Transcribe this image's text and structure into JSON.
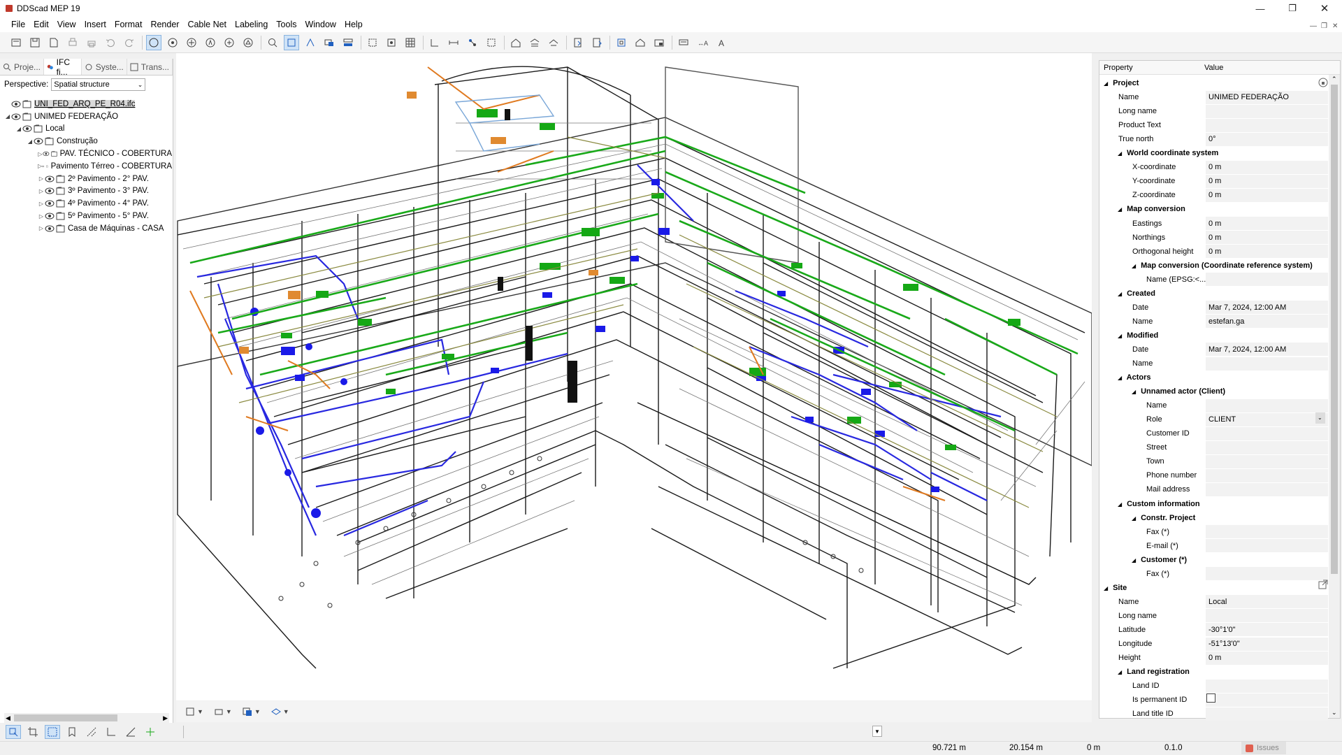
{
  "window": {
    "title": "DDScad MEP 19"
  },
  "menu": [
    "File",
    "Edit",
    "View",
    "Insert",
    "Format",
    "Render",
    "Cable Net",
    "Labeling",
    "Tools",
    "Window",
    "Help"
  ],
  "left_panel": {
    "tabs": [
      "Proje...",
      "IFC fi...",
      "Syste...",
      "Trans..."
    ],
    "perspective_label": "Perspective:",
    "perspective_value": "Spatial structure",
    "tree": [
      {
        "label": "UNI_FED_ARQ_PE_R04.ifc",
        "level": 0,
        "expander": "",
        "selected": true
      },
      {
        "label": "UNIMED FEDERAÇÃO",
        "level": 0,
        "expander": "◢"
      },
      {
        "label": "Local",
        "level": 1,
        "expander": "◢"
      },
      {
        "label": "Construção",
        "level": 2,
        "expander": "◢"
      },
      {
        "label": "PAV. TÉCNICO - COBERTURA",
        "level": 3,
        "expander": "▷"
      },
      {
        "label": "Pavimento Térreo - COBERTURA",
        "level": 3,
        "expander": "▷"
      },
      {
        "label": "2º Pavimento - 2° PAV.",
        "level": 3,
        "expander": "▷"
      },
      {
        "label": "3º Pavimento - 3° PAV.",
        "level": 3,
        "expander": "▷"
      },
      {
        "label": "4º Pavimento - 4° PAV.",
        "level": 3,
        "expander": "▷"
      },
      {
        "label": "5º Pavimento - 5° PAV.",
        "level": 3,
        "expander": "▷"
      },
      {
        "label": "Casa de Máquinas - CASA",
        "level": 3,
        "expander": "▷"
      }
    ]
  },
  "properties": {
    "col_property": "Property",
    "col_value": "Value",
    "rows": [
      {
        "t": "g",
        "l": 0,
        "n": "Project"
      },
      {
        "l": 1,
        "n": "Name",
        "v": "UNIMED FEDERAÇÃO"
      },
      {
        "l": 1,
        "n": "Long name",
        "v": ""
      },
      {
        "l": 1,
        "n": "Product Text",
        "v": ""
      },
      {
        "l": 1,
        "n": "True north",
        "v": "0°"
      },
      {
        "t": "g",
        "l": 1,
        "n": "World coordinate system"
      },
      {
        "l": 2,
        "n": "X-coordinate",
        "v": "0 m"
      },
      {
        "l": 2,
        "n": "Y-coordinate",
        "v": "0 m"
      },
      {
        "l": 2,
        "n": "Z-coordinate",
        "v": "0 m"
      },
      {
        "t": "g",
        "l": 1,
        "n": "Map conversion"
      },
      {
        "l": 2,
        "n": "Eastings",
        "v": "0 m"
      },
      {
        "l": 2,
        "n": "Northings",
        "v": "0 m"
      },
      {
        "l": 2,
        "n": "Orthogonal height",
        "v": "0 m"
      },
      {
        "t": "g",
        "l": 2,
        "n": "Map conversion (Coordinate reference system)"
      },
      {
        "l": 3,
        "n": "Name (EPSG:<...",
        "v": ""
      },
      {
        "t": "g",
        "l": 1,
        "n": "Created"
      },
      {
        "l": 2,
        "n": "Date",
        "v": "Mar 7, 2024, 12:00 AM"
      },
      {
        "l": 2,
        "n": "Name",
        "v": "estefan.ga"
      },
      {
        "t": "g",
        "l": 1,
        "n": "Modified"
      },
      {
        "l": 2,
        "n": "Date",
        "v": "Mar 7, 2024, 12:00 AM"
      },
      {
        "l": 2,
        "n": "Name",
        "v": ""
      },
      {
        "t": "g",
        "l": 1,
        "n": "Actors"
      },
      {
        "t": "g",
        "l": 2,
        "n": "Unnamed actor (Client)"
      },
      {
        "l": 3,
        "n": "Name",
        "v": ""
      },
      {
        "l": 3,
        "n": "Role",
        "v": "CLIENT"
      },
      {
        "l": 3,
        "n": "Customer ID",
        "v": ""
      },
      {
        "l": 3,
        "n": "Street",
        "v": ""
      },
      {
        "l": 3,
        "n": "Town",
        "v": ""
      },
      {
        "l": 3,
        "n": "Phone number",
        "v": ""
      },
      {
        "l": 3,
        "n": "Mail address",
        "v": ""
      },
      {
        "t": "g",
        "l": 1,
        "n": "Custom information"
      },
      {
        "t": "g",
        "l": 2,
        "n": "Constr. Project"
      },
      {
        "l": 3,
        "n": "Fax (*)",
        "v": ""
      },
      {
        "l": 3,
        "n": "E-mail (*)",
        "v": ""
      },
      {
        "t": "g",
        "l": 2,
        "n": "Customer (*)"
      },
      {
        "l": 3,
        "n": "Fax (*)",
        "v": ""
      },
      {
        "t": "g",
        "l": 0,
        "n": "Site"
      },
      {
        "l": 1,
        "n": "Name",
        "v": "Local"
      },
      {
        "l": 1,
        "n": "Long name",
        "v": ""
      },
      {
        "l": 1,
        "n": "Latitude",
        "v": "-30°1'0\""
      },
      {
        "l": 1,
        "n": "Longitude",
        "v": "-51°13'0\""
      },
      {
        "l": 1,
        "n": "Height",
        "v": "0 m"
      },
      {
        "t": "g",
        "l": 1,
        "n": "Land registration"
      },
      {
        "l": 2,
        "n": "Land ID",
        "v": ""
      },
      {
        "l": 2,
        "n": "Is permanent ID",
        "v": ""
      },
      {
        "l": 2,
        "n": "Land title ID",
        "v": ""
      }
    ]
  },
  "status": {
    "x": "90.721 m",
    "y": "20.154 m",
    "z": "0 m",
    "scale": "0.1.0",
    "issues": "Issues"
  },
  "colors": {
    "accent": "#cfe3f7",
    "pipe_blue": "#2020e0",
    "duct_green": "#18a818",
    "cable_orange": "#e07820"
  }
}
